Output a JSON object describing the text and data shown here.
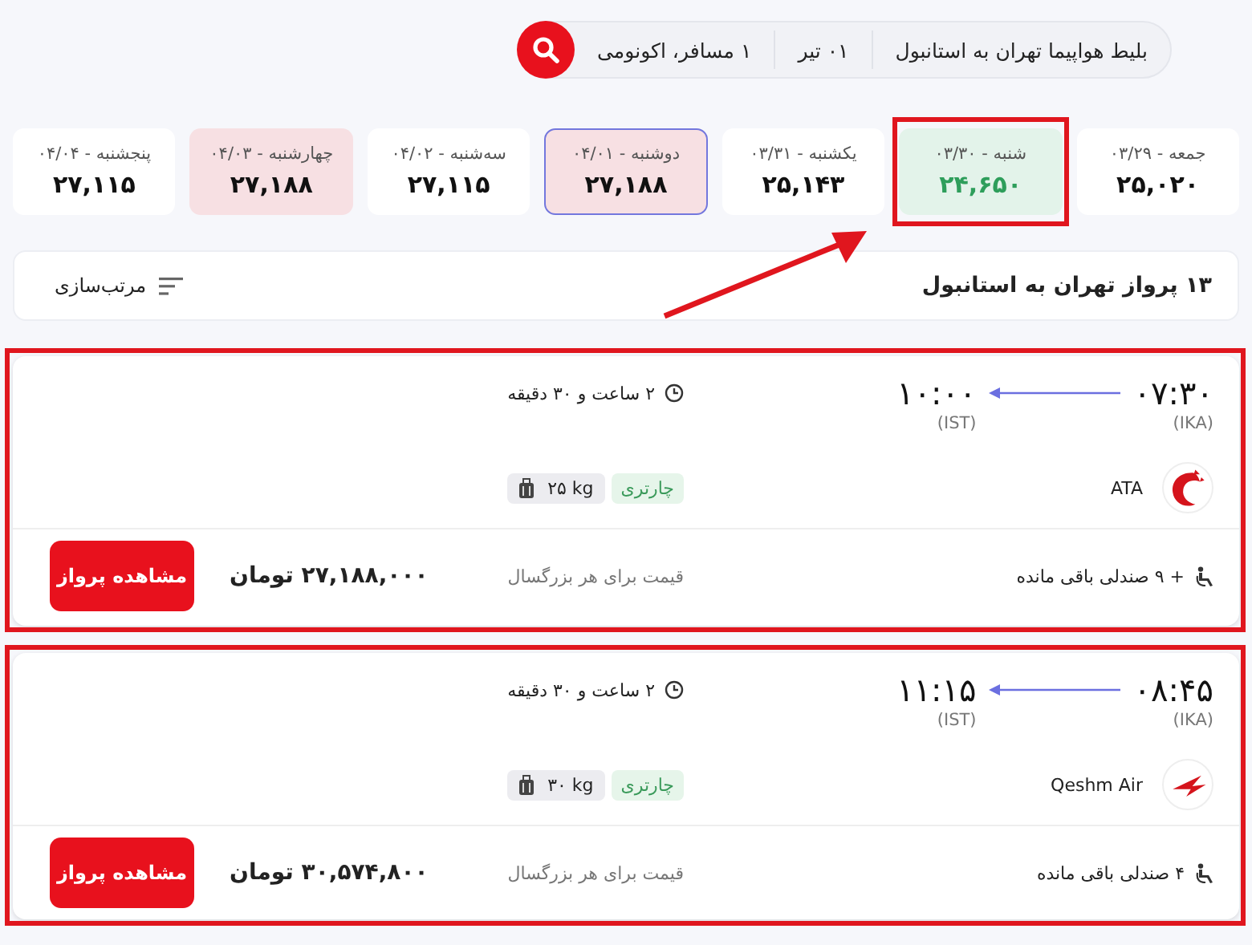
{
  "search": {
    "route": "بلیط هواپیما تهران به استانبول",
    "date": "۰۱ تیر",
    "passengers": "۱ مسافر، اکونومی"
  },
  "dates": [
    {
      "label": "جمعه - ۰۳/۲۹",
      "price": "۲۵,۰۲۰",
      "selected": false,
      "kind": "normal",
      "highlighted": false
    },
    {
      "label": "شنبه - ۰۳/۳۰",
      "price": "۲۴,۶۵۰",
      "selected": false,
      "kind": "low",
      "highlighted": true
    },
    {
      "label": "یکشنبه - ۰۳/۳۱",
      "price": "۲۵,۱۴۳",
      "selected": false,
      "kind": "normal",
      "highlighted": false
    },
    {
      "label": "دوشنبه - ۰۴/۰۱",
      "price": "۲۷,۱۸۸",
      "selected": true,
      "kind": "high",
      "highlighted": false
    },
    {
      "label": "سه‌شنبه - ۰۴/۰۲",
      "price": "۲۷,۱۱۵",
      "selected": false,
      "kind": "normal",
      "highlighted": false
    },
    {
      "label": "چهارشنبه - ۰۴/۰۳",
      "price": "۲۷,۱۸۸",
      "selected": false,
      "kind": "high",
      "highlighted": false
    },
    {
      "label": "پنجشنبه - ۰۴/۰۴",
      "price": "۲۷,۱۱۵",
      "selected": false,
      "kind": "normal",
      "highlighted": false
    }
  ],
  "results_header": {
    "title": "۱۳ پرواز تهران به استانبول",
    "sort": "مرتب‌سازی"
  },
  "annotation_arrow": true,
  "flights": [
    {
      "departure_time": "۰۷:۳۰",
      "departure_airport": "(IKA)",
      "arrival_time": "۱۰:۰۰",
      "arrival_airport": "(IST)",
      "duration": "۲ ساعت و ۳۰ دقیقه",
      "airline": "ATA",
      "kind": "swirl",
      "tag": "چارتری",
      "baggage": "۲۵ kg",
      "seats": "+ ۹ صندلی باقی مانده",
      "price_note": "قیمت برای هر بزرگسال",
      "price": "۲۷,۱۸۸,۰۰۰ تومان",
      "button": "مشاهده پرواز",
      "highlighted": true
    },
    {
      "departure_time": "۰۸:۴۵",
      "departure_airport": "(IKA)",
      "arrival_time": "۱۱:۱۵",
      "arrival_airport": "(IST)",
      "duration": "۲ ساعت و ۳۰ دقیقه",
      "airline": "Qeshm Air",
      "kind": "wing",
      "tag": "چارتری",
      "baggage": "۳۰ kg",
      "seats": "۴ صندلی باقی مانده",
      "price_note": "قیمت برای هر بزرگسال",
      "price": "۳۰,۵۷۴,۸۰۰ تومان",
      "button": "مشاهده پرواز",
      "highlighted": true
    }
  ]
}
